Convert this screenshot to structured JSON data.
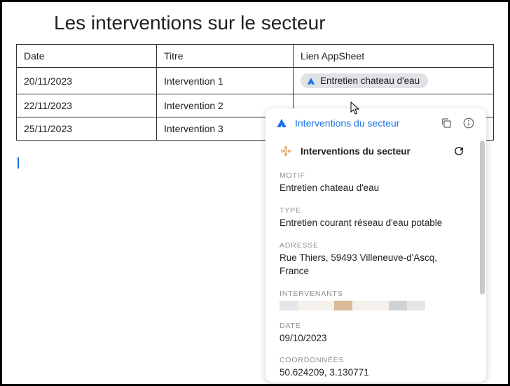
{
  "page_title": "Les interventions sur le secteur",
  "table": {
    "headers": {
      "date": "Date",
      "titre": "Titre",
      "lien": "Lien AppSheet"
    },
    "rows": [
      {
        "date": "20/11/2023",
        "titre": "Intervention 1",
        "lien": "Entretien chateau d'eau"
      },
      {
        "date": "22/11/2023",
        "titre": "Intervention 2",
        "lien": ""
      },
      {
        "date": "25/11/2023",
        "titre": "Intervention 3",
        "lien": ""
      }
    ]
  },
  "popup": {
    "header_link": "Interventions du secteur",
    "card_title": "Interventions du secteur",
    "fields": {
      "motif": {
        "label": "MOTIF",
        "value": "Entretien chateau d'eau"
      },
      "type": {
        "label": "TYPE",
        "value": "Entretien courant réseau d'eau potable"
      },
      "adresse": {
        "label": "ADRESSE",
        "value": "Rue Thiers, 59493 Villeneuve-d'Ascq, France"
      },
      "intervenants": {
        "label": "INTERVENANTS",
        "swatches": [
          "#e4e6e8",
          "#f4f1ed",
          "#f4f1ed",
          "#d7bb97",
          "#f4f1ed",
          "#f4f1ed",
          "#cfd3d6",
          "#e4e6e8"
        ]
      },
      "date": {
        "label": "DATE",
        "value": "09/10/2023"
      },
      "coordonnees": {
        "label": "COORDONNÉES",
        "value": "50.624209, 3.130771"
      }
    }
  }
}
